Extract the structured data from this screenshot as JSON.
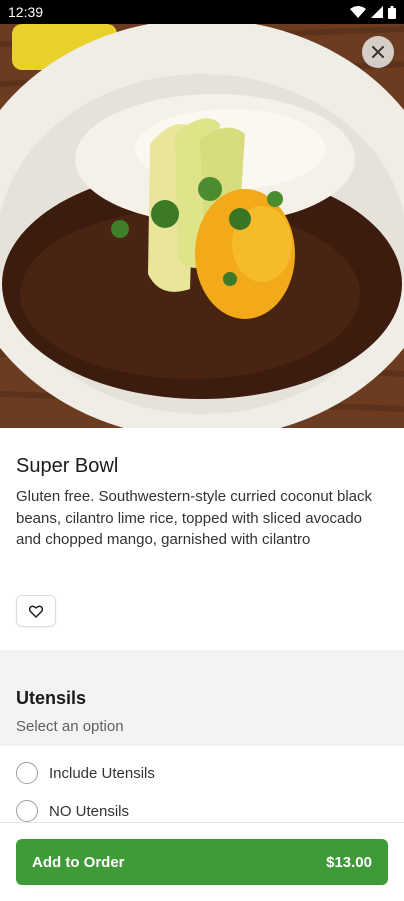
{
  "status_bar": {
    "time": "12:39"
  },
  "product": {
    "title": "Super Bowl",
    "description": "Gluten free. Southwestern-style curried coconut black beans, cilantro lime rice, topped with sliced avocado and chopped mango, garnished with cilantro"
  },
  "utensils": {
    "title": "Utensils",
    "subtitle": "Select an option",
    "options": [
      "Include Utensils",
      "NO Utensils"
    ]
  },
  "order": {
    "label": "Add to Order",
    "price": "$13.00"
  },
  "colors": {
    "accent": "#3f9a38"
  },
  "icons": [
    "wifi-icon",
    "signal-icon",
    "battery-icon",
    "close-icon",
    "heart-icon"
  ]
}
